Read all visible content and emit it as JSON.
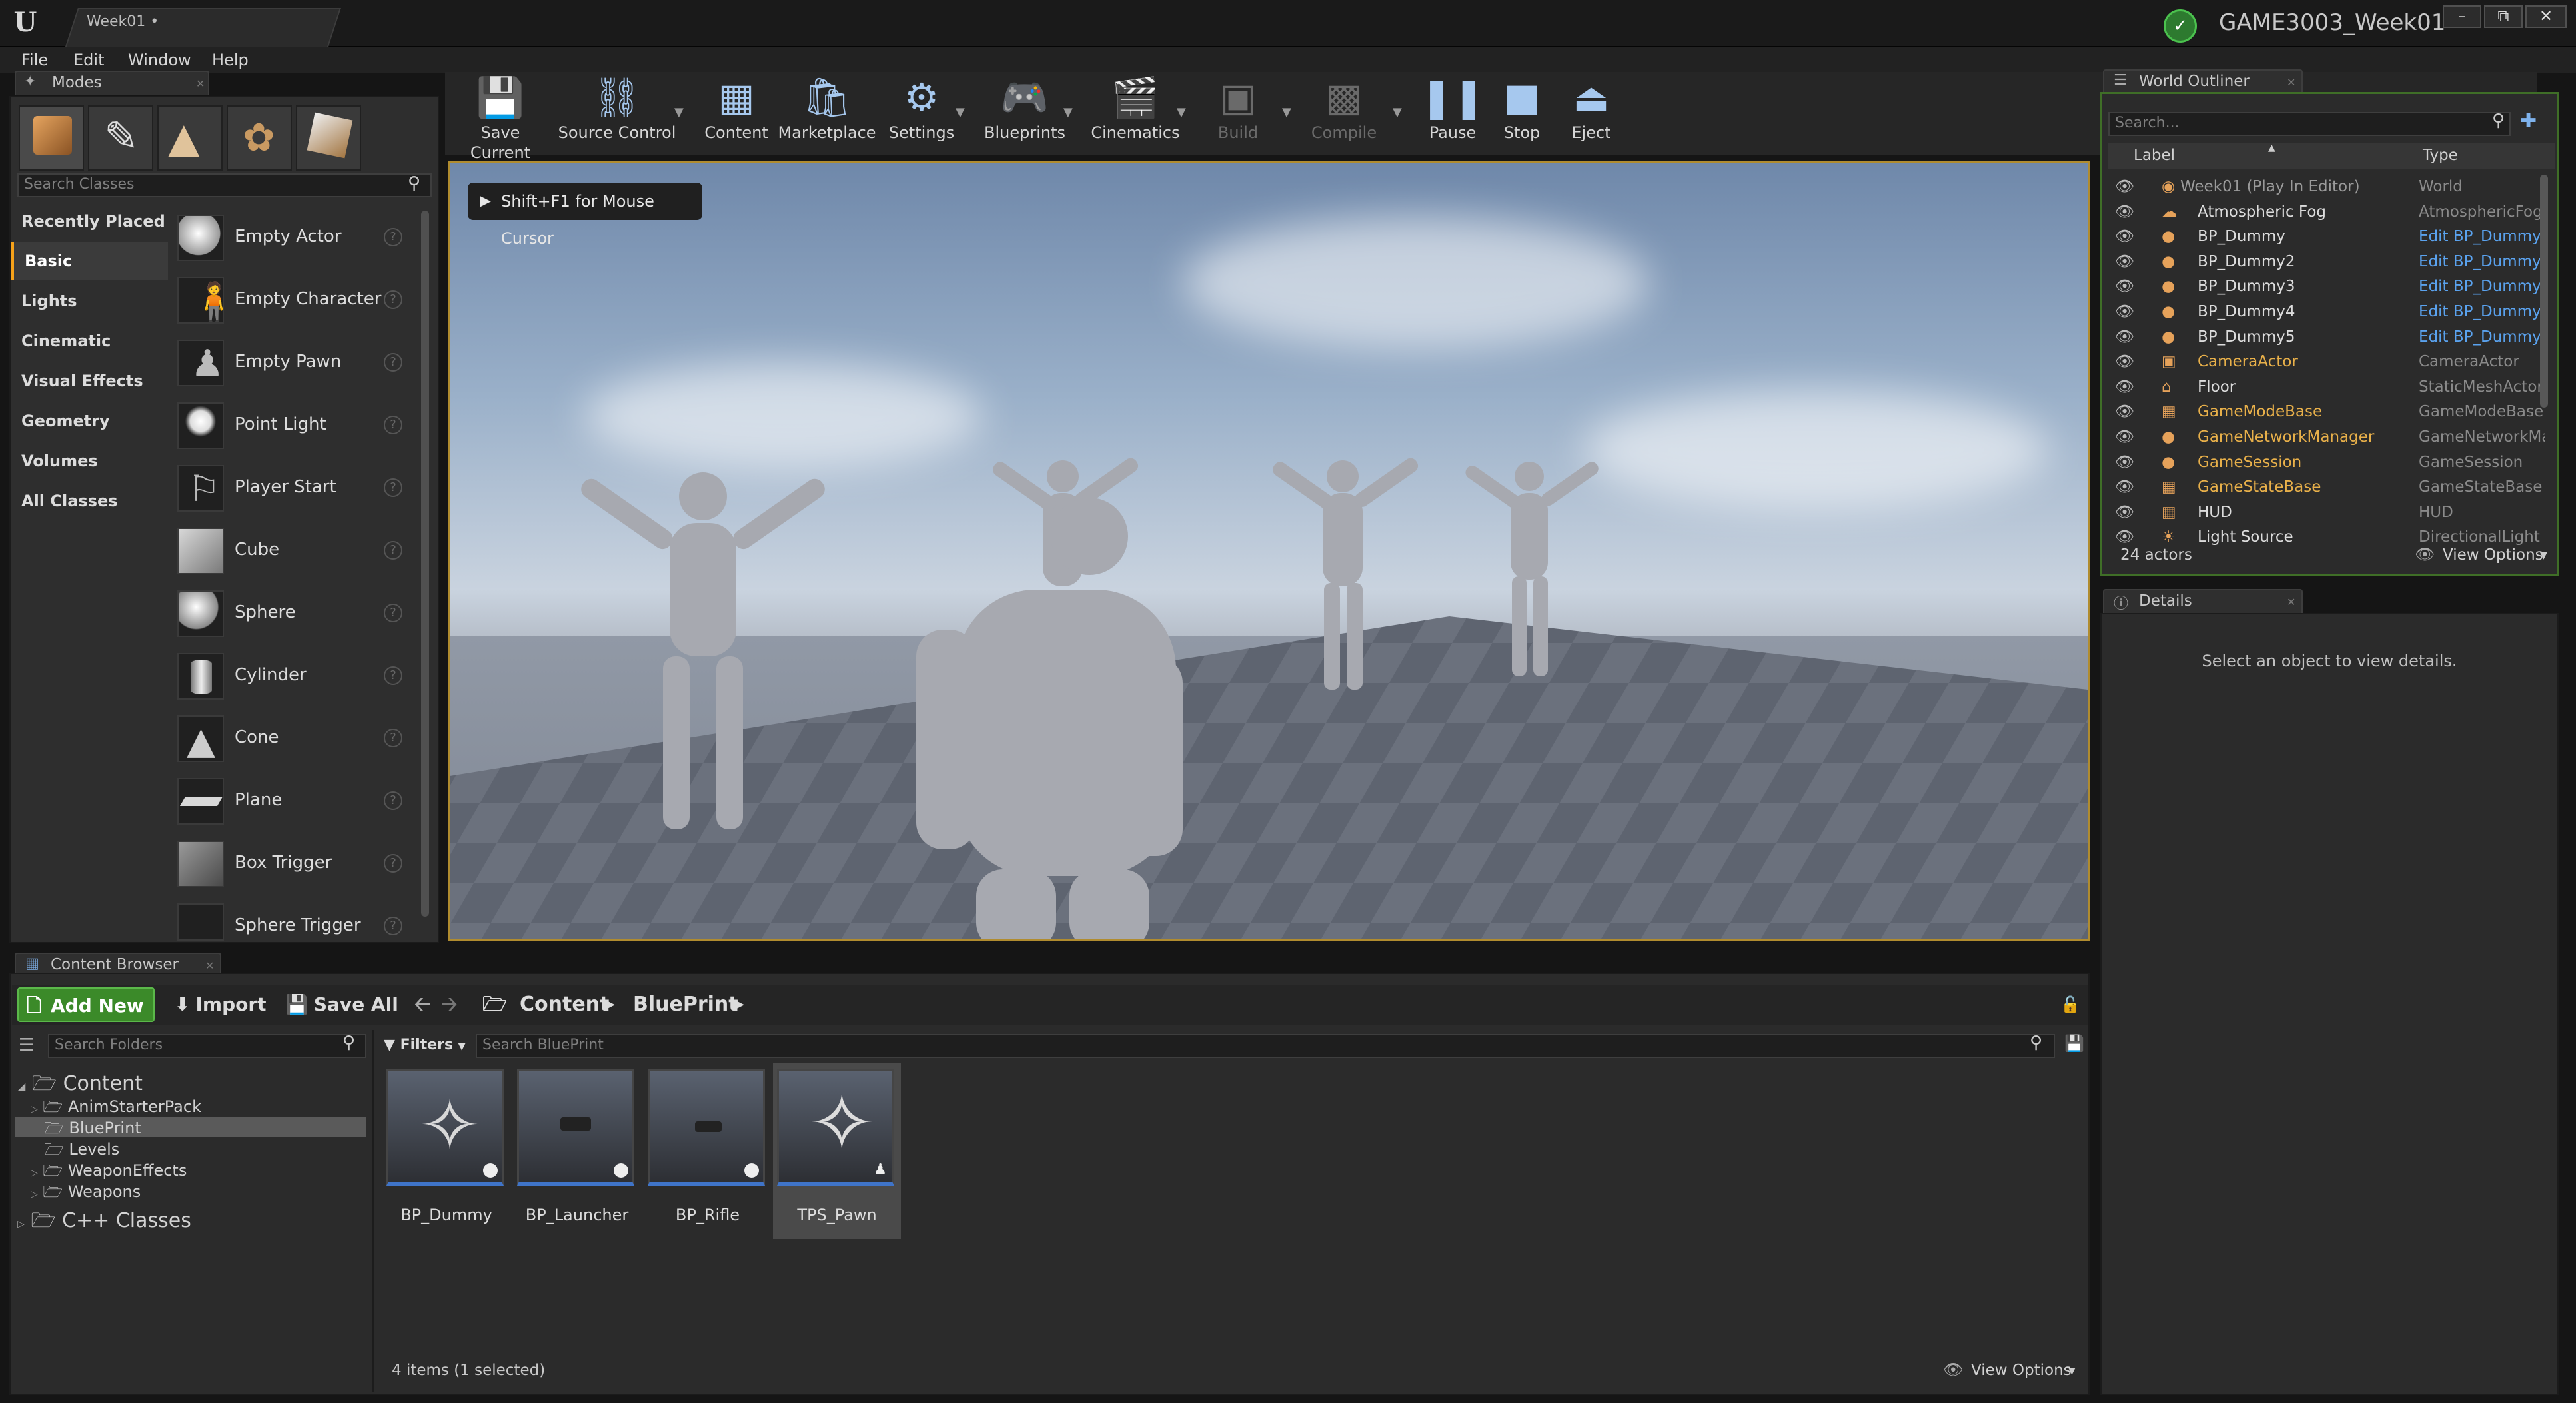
{
  "window": {
    "tab_title": "Week01 •",
    "project_name": "GAME3003_Week01",
    "minimize": "–",
    "maximize": "⧉",
    "close": "✕"
  },
  "menu": [
    "File",
    "Edit",
    "Window",
    "Help"
  ],
  "modes": {
    "tab_label": "Modes",
    "search_placeholder": "Search Classes",
    "categories": [
      "Recently Placed",
      "Basic",
      "Lights",
      "Cinematic",
      "Visual Effects",
      "Geometry",
      "Volumes",
      "All Classes"
    ],
    "active_category": "Basic",
    "items": [
      "Empty Actor",
      "Empty Character",
      "Empty Pawn",
      "Point Light",
      "Player Start",
      "Cube",
      "Sphere",
      "Cylinder",
      "Cone",
      "Plane",
      "Box Trigger",
      "Sphere Trigger"
    ],
    "help_glyph": "?"
  },
  "toolbar": {
    "save_current": "Save Current",
    "source_control": "Source Control",
    "content": "Content",
    "marketplace": "Marketplace",
    "settings": "Settings",
    "blueprints": "Blueprints",
    "cinematics": "Cinematics",
    "build": "Build",
    "compile": "Compile",
    "pause": "Pause",
    "stop": "Stop",
    "eject": "Eject"
  },
  "viewport": {
    "hint": "Shift+F1 for Mouse Cursor"
  },
  "outliner": {
    "tab_label": "World Outliner",
    "search_placeholder": "Search...",
    "col_label": "Label",
    "col_type": "Type",
    "rows": [
      {
        "label": "Week01 (Play In Editor)",
        "type": "World"
      },
      {
        "label": "Atmospheric Fog",
        "type": "AtmosphericFog"
      },
      {
        "label": "BP_Dummy",
        "type": "Edit BP_Dummy"
      },
      {
        "label": "BP_Dummy2",
        "type": "Edit BP_Dummy"
      },
      {
        "label": "BP_Dummy3",
        "type": "Edit BP_Dummy"
      },
      {
        "label": "BP_Dummy4",
        "type": "Edit BP_Dummy"
      },
      {
        "label": "BP_Dummy5",
        "type": "Edit BP_Dummy"
      },
      {
        "label": "CameraActor",
        "type": "CameraActor"
      },
      {
        "label": "Floor",
        "type": "StaticMeshActor"
      },
      {
        "label": "GameModeBase",
        "type": "GameModeBase"
      },
      {
        "label": "GameNetworkManager",
        "type": "GameNetworkManager"
      },
      {
        "label": "GameSession",
        "type": "GameSession"
      },
      {
        "label": "GameStateBase",
        "type": "GameStateBase"
      },
      {
        "label": "HUD",
        "type": "HUD"
      },
      {
        "label": "Light Source",
        "type": "DirectionalLight"
      }
    ],
    "actor_count": "24 actors",
    "view_options": "View Options"
  },
  "details": {
    "tab_label": "Details",
    "empty_message": "Select an object to view details."
  },
  "content_browser": {
    "tab_label": "Content Browser",
    "add_new": "Add New",
    "import": "Import",
    "save_all": "Save All",
    "breadcrumb": [
      "Content",
      "BluePrint"
    ],
    "folder_search_placeholder": "Search Folders",
    "filters": "Filters",
    "asset_search_placeholder": "Search BluePrint",
    "tree": {
      "root": "Content",
      "children": [
        "AnimStarterPack",
        "BluePrint",
        "Levels",
        "WeaponEffects",
        "Weapons"
      ],
      "cpp": "C++ Classes"
    },
    "assets": [
      "BP_Dummy",
      "BP_Launcher",
      "BP_Rifle",
      "TPS_Pawn"
    ],
    "selected_asset": "TPS_Pawn",
    "status": "4 items (1 selected)",
    "view_options": "View Options"
  },
  "colors": {
    "accent_orange": "#f6a21a",
    "add_new_green": "#3b8a29",
    "link_blue": "#5aa2ee",
    "viewport_border": "#b08c2f"
  }
}
